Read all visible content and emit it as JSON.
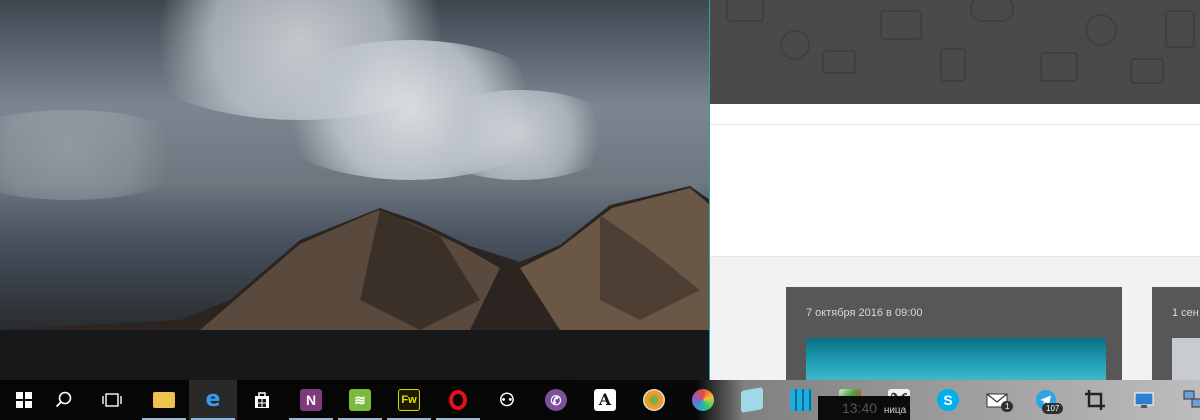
{
  "colors": {
    "taskbar_underline": "#9fb6d0",
    "page_header": "#4a4a4a",
    "card": "#575757",
    "accent_separator": "#2aa3a8"
  },
  "page": {
    "cards": [
      {
        "date": "7 октября 2016 в 09:00"
      },
      {
        "date": "1 сен"
      }
    ]
  },
  "taskbar": {
    "start_icon": "windows-logo-icon",
    "search_icon": "magnifier-icon",
    "task_view_icon": "task-view-icon",
    "pinned_icons": [
      "file-explorer-icon",
      "edge-icon",
      "store-icon",
      "onenote-icon",
      "rss-reader-icon",
      "fireworks-icon",
      "opera-icon",
      "contacts-icon",
      "viber-icon",
      "font-app-icon",
      "xnview-icon",
      "paint-icon",
      "notepad-icon",
      "azure-storage-icon",
      "mindmap-icon",
      "handwriting-icon",
      "skype-icon",
      "mail-icon",
      "telegram-icon",
      "crop-tool-icon",
      "remote-desktop-icon",
      "network-icon"
    ],
    "fw_label": "Fw",
    "mail_badge": "1",
    "telegram_badge": "107",
    "clock_fragment": "13:40",
    "preview_fragment": "ница"
  }
}
